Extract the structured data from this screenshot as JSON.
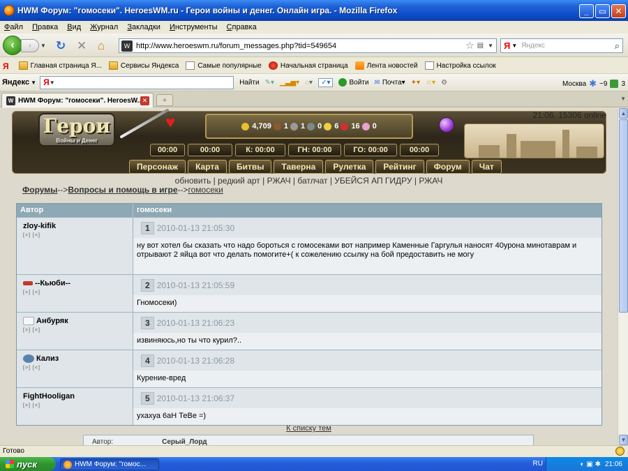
{
  "window": {
    "title": "HWM Форум: \"гомосеки\". HeroesWM.ru - Герои войны и денег. Онлайн игра. - Mozilla Firefox",
    "buttons": [
      "_",
      "▭",
      "✕"
    ]
  },
  "menu": [
    "Файл",
    "Правка",
    "Вид",
    "Журнал",
    "Закладки",
    "Инструменты",
    "Справка"
  ],
  "navbar": {
    "url": "http://www.heroeswm.ru/forum_messages.php?tid=549654",
    "search_placeholder": "Яндекс",
    "search_engine": "Я"
  },
  "bookmarks": [
    {
      "label": "Главная страница Я...",
      "icon": "folder-icon"
    },
    {
      "label": "Сервисы Яндекса",
      "icon": "folder-icon"
    },
    {
      "label": "Самые популярные",
      "icon": "doc-icon"
    },
    {
      "label": "Начальная страница",
      "icon": "flame-icon"
    },
    {
      "label": "Лента новостей",
      "icon": "rss-icon"
    },
    {
      "label": "Настройка ссылок",
      "icon": "doc-icon"
    }
  ],
  "yandex_bar": {
    "logo": "Яндекс",
    "find": "Найти",
    "login": "Войти",
    "mail": "Почта",
    "city": "Москва",
    "temp": "−9",
    "count": "3"
  },
  "tab": {
    "label": "HWM Форум: \"гомосеки\". HeroesW..."
  },
  "game": {
    "logo": "Герои",
    "logo_sub": "Войны и Денег",
    "online": "21:06, 15306 online",
    "resources": [
      "4,709",
      "1",
      "1",
      "0",
      "6",
      "16",
      "0"
    ],
    "timers": [
      "00:00",
      "00:00",
      "К: 00:00",
      "ГН: 00:00",
      "ГО: 00:00",
      "00:00"
    ],
    "nav": [
      "Персонаж",
      "Карта",
      "Битвы",
      "Таверна",
      "Рулетка",
      "Рейтинг",
      "Форум",
      "Чат"
    ],
    "links": "обновить | редкий арт | РЖАЧ | батлчат | УБЕЙСЯ АП ГИДРУ | РЖАЧ"
  },
  "breadcrumb": {
    "forums": "Форумы",
    "sep1": "-->",
    "section": "Вопросы и помощь в игре",
    "sep2": "-->",
    "topic": "гомосеки"
  },
  "table": {
    "col_author": "Автор",
    "col_topic": "гомосеки",
    "posts": [
      {
        "author": "zloy-kifik",
        "num": "1",
        "date": "2010-01-13 21:05:30",
        "text": "ну вот хотел бы сказать что надо бороться с гомосеками вот например Каменные Гаргулья наносят 40урона минотаврам и отрывают 2 яйца вот что делать помогите+( к сожелению ссылку на бой предоставить не могу",
        "avatar_color": ""
      },
      {
        "author": "--Кьюби--",
        "num": "2",
        "date": "2010-01-13 21:05:59",
        "text": "Гномосеки)",
        "avatar_color": "#c0392b"
      },
      {
        "author": "Анбуряк",
        "num": "3",
        "date": "2010-01-13 21:06:23",
        "text": "извиняюсь,но ты что курил?..",
        "avatar_color": "#dfe8f0"
      },
      {
        "author": "Кализ",
        "num": "4",
        "date": "2010-01-13 21:06:28",
        "text": "Курение-вред",
        "avatar_color": "#5a82b0"
      },
      {
        "author": "FightHooligan",
        "num": "5",
        "date": "2010-01-13 21:06:37",
        "text": "ухахуа 6аН ТеВе =)",
        "avatar_color": ""
      }
    ],
    "author_controls": "[>] [<]"
  },
  "to_list": "К списку тем",
  "next_table": {
    "col_author": "Автор:",
    "author": "Серый_Лорд"
  },
  "status": "Готово",
  "taskbar": {
    "start": "пуск",
    "task": "HWM Форум: \"гомос...",
    "lang": "RU",
    "time": "21:06"
  }
}
